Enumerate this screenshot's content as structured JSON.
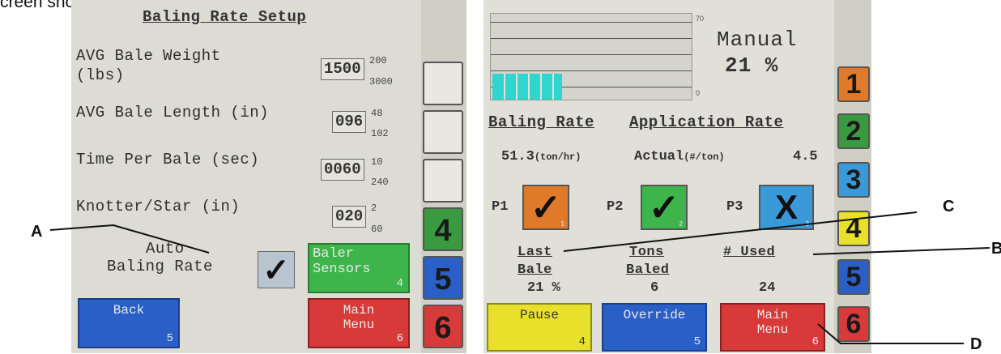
{
  "caption": "creen shown below and to the right should appear.",
  "left": {
    "title": "Baling Rate Setup",
    "rows": [
      {
        "label1": "AVG Bale Weight",
        "label2": "(lbs)",
        "value": "1500",
        "min": "200",
        "max": "3000"
      },
      {
        "label1": "AVG Bale Length (in)",
        "label2": "",
        "value": "096",
        "min": "48",
        "max": "102"
      },
      {
        "label1": "Time Per Bale (sec)",
        "label2": "",
        "value": "0060",
        "min": "10",
        "max": "240"
      },
      {
        "label1": "Knotter/Star (in)",
        "label2": "",
        "value": "020",
        "min": "2",
        "max": "60"
      }
    ],
    "auto_label1": "Auto",
    "auto_label2": "Baling Rate",
    "auto_checked": "✓",
    "baler_sensors_1": "Baler",
    "baler_sensors_2": "Sensors",
    "baler_sensors_num": "4",
    "back_label": "Back",
    "back_num": "5",
    "main_menu_1": "Main",
    "main_menu_2": "Menu",
    "main_menu_num": "6",
    "side": [
      "",
      "",
      "",
      "4",
      "5",
      "6"
    ]
  },
  "right": {
    "gauge_max": "70",
    "gauge_min": "0",
    "gauge_level_fraction": 0.3,
    "mode": "Manual",
    "percent": "21 %",
    "hdr_baling": "Baling Rate",
    "hdr_app": "Application Rate",
    "baling_value": "51.3",
    "baling_unit": "(ton/hr)",
    "actual_label": "Actual",
    "actual_unit": "(#/ton)",
    "actual_value": "4.5",
    "pumps": [
      {
        "label": "P1",
        "symbol": "✓",
        "num": "1",
        "color": "#e07a2a"
      },
      {
        "label": "P2",
        "symbol": "✓",
        "num": "2",
        "color": "#3db54a"
      },
      {
        "label": "P3",
        "symbol": "X",
        "num": "3",
        "color": "#3a9ad9"
      }
    ],
    "stat_last_1": "Last",
    "stat_last_2": "Bale",
    "stat_last_val": "21 %",
    "stat_tons_1": "Tons",
    "stat_tons_2": "Baled",
    "stat_tons_val": "6",
    "stat_used": "# Used",
    "stat_used_val": "24",
    "pause_label": "Pause",
    "pause_num": "4",
    "override_label": "Override",
    "override_num": "5",
    "main_menu_1": "Main",
    "main_menu_2": "Menu",
    "main_menu_num": "6",
    "side": [
      "1",
      "2",
      "3",
      "4",
      "5",
      "6"
    ]
  },
  "callouts": {
    "A": "A",
    "B": "B",
    "C": "C",
    "D": "D"
  },
  "colors": {
    "orange": "#e07a2a",
    "green": "#3db54a",
    "blue": "#3a9ad9",
    "yellow": "#e8e02a",
    "dark_blue": "#2a5fc8",
    "red": "#d83a3a",
    "green_dark": "#3a9a40",
    "teal": "#2fd6cf"
  }
}
